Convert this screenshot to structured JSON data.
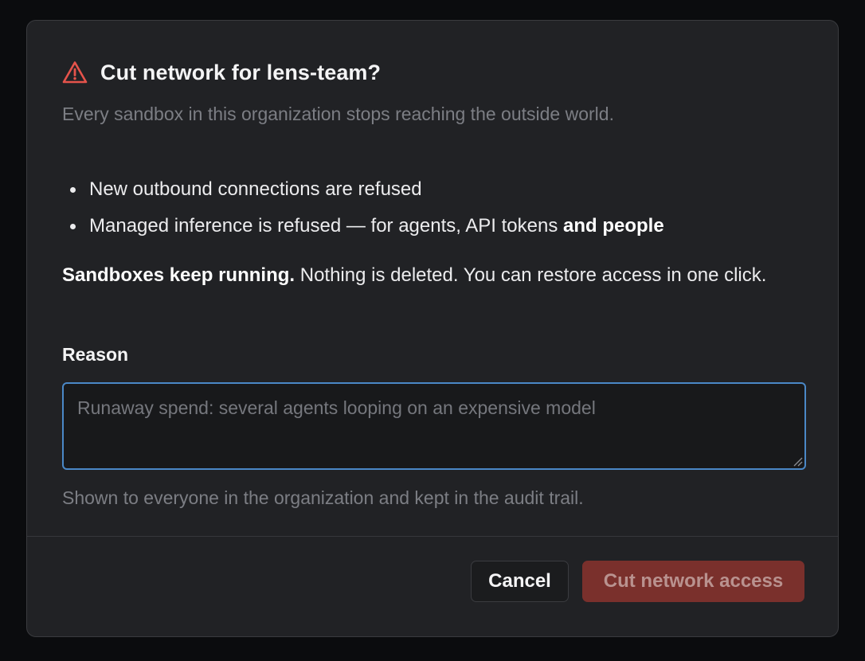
{
  "dialog": {
    "title": "Cut network for lens-team?",
    "subtitle": "Every sandbox in this organization stops reaching the outside world.",
    "bullets": [
      {
        "text": "New outbound connections are refused",
        "bold": ""
      },
      {
        "text": "Managed inference is refused — for agents, API tokens ",
        "bold": "and people"
      }
    ],
    "note": {
      "bold": "Sandboxes keep running.",
      "text": " Nothing is deleted. You can restore access in one click."
    },
    "reason": {
      "label": "Reason",
      "placeholder": "Runaway spend: several agents looping on an expensive model",
      "value": "",
      "help": "Shown to everyone in the organization and kept in the audit trail."
    },
    "buttons": {
      "cancel": "Cancel",
      "confirm": "Cut network access"
    }
  },
  "icons": {
    "warning": "warning-triangle-icon",
    "resize": "resize-grip-icon"
  },
  "colors": {
    "warning": "#e5534b",
    "danger_button": "#7a302c",
    "danger_button_text": "#b9928f",
    "focus_border": "#4a88c7"
  }
}
